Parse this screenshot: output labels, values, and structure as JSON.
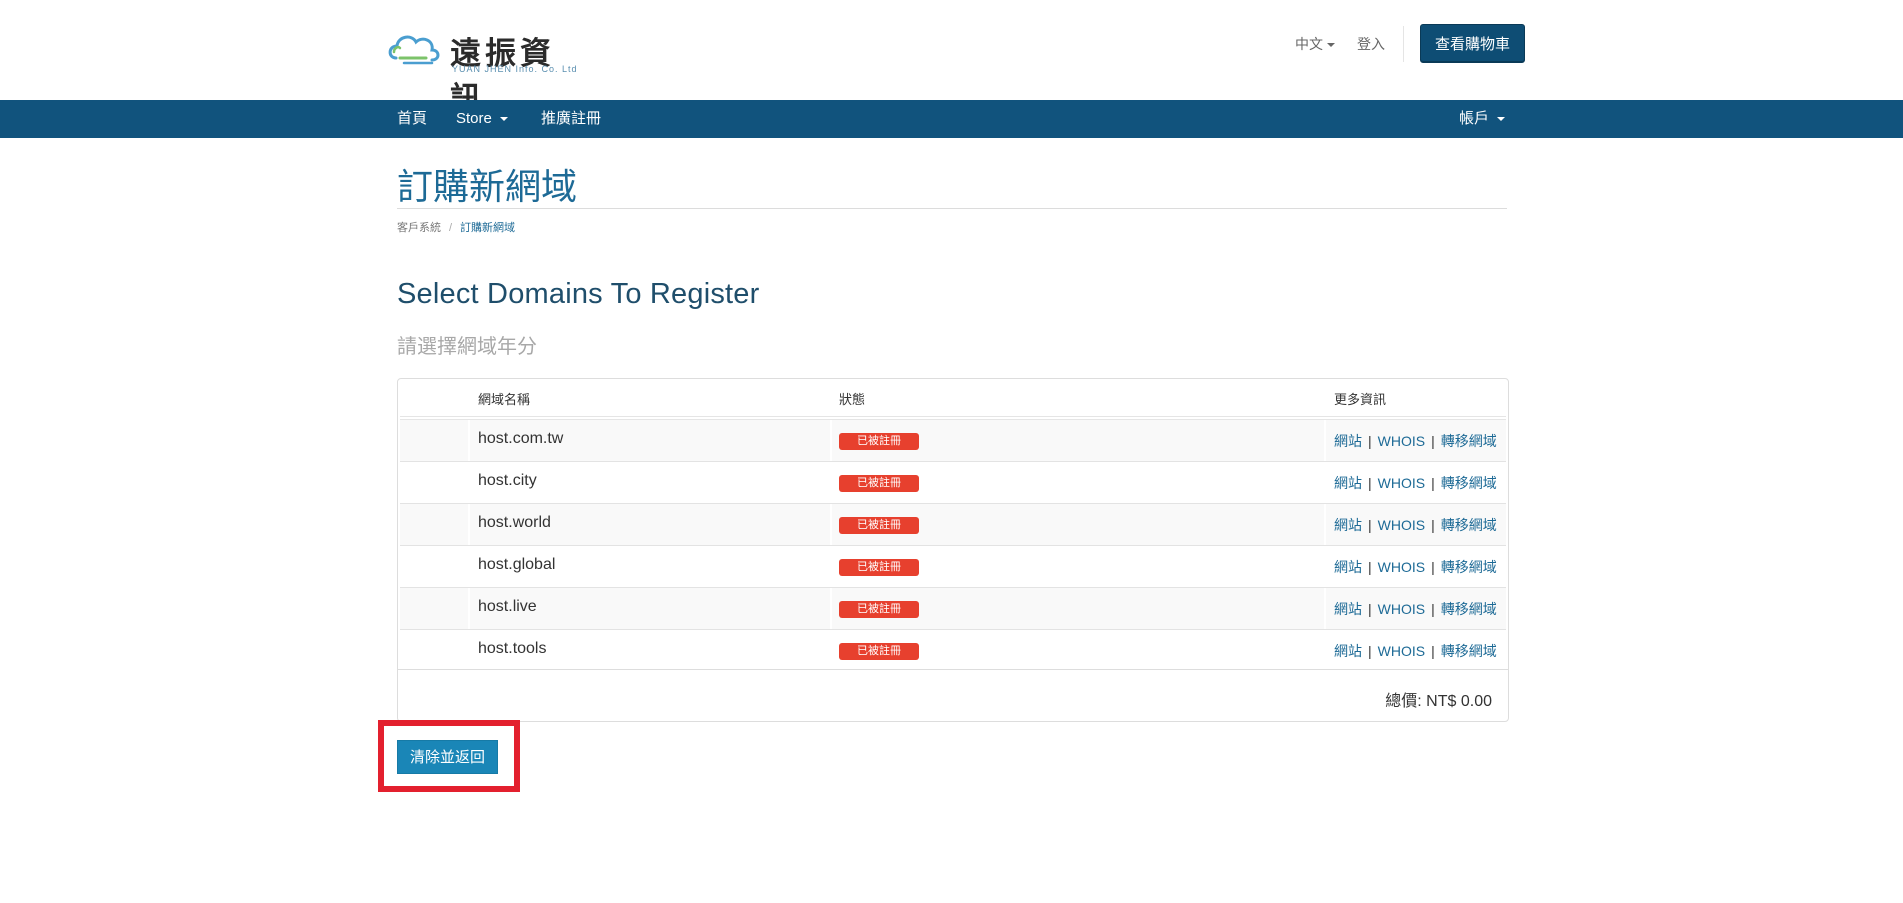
{
  "header": {
    "logo_cn": "遠振資訊",
    "logo_en": "YUAN JHEN Info. Co. Ltd",
    "language": "中文",
    "login": "登入",
    "cart_button": "查看購物車"
  },
  "nav": {
    "home": "首頁",
    "store": "Store",
    "affiliate": "推廣註冊",
    "account": "帳戶"
  },
  "page": {
    "title": "訂購新網域",
    "breadcrumb": [
      "客戶系統",
      "訂購新網域"
    ],
    "section_title": "Select Domains To Register",
    "subtitle": "請選擇網域年分"
  },
  "table": {
    "headers": [
      "網域名稱",
      "狀態",
      "更多資訊"
    ],
    "rows": [
      {
        "domain": "host.com.tw",
        "status": "已被註冊"
      },
      {
        "domain": "host.city",
        "status": "已被註冊"
      },
      {
        "domain": "host.world",
        "status": "已被註冊"
      },
      {
        "domain": "host.global",
        "status": "已被註冊"
      },
      {
        "domain": "host.live",
        "status": "已被註冊"
      },
      {
        "domain": "host.tools",
        "status": "已被註冊"
      }
    ],
    "links": {
      "website": "網站",
      "whois": "WHOIS",
      "transfer": "轉移網域"
    },
    "total": "總價: NT$ 0.00"
  },
  "actions": {
    "clear_button": "清除並返回"
  },
  "colors": {
    "nav_bg": "#11537d",
    "title": "#1d6a96",
    "badge": "#e7402e",
    "button": "#1a86b7",
    "highlight": "#e3202e"
  }
}
